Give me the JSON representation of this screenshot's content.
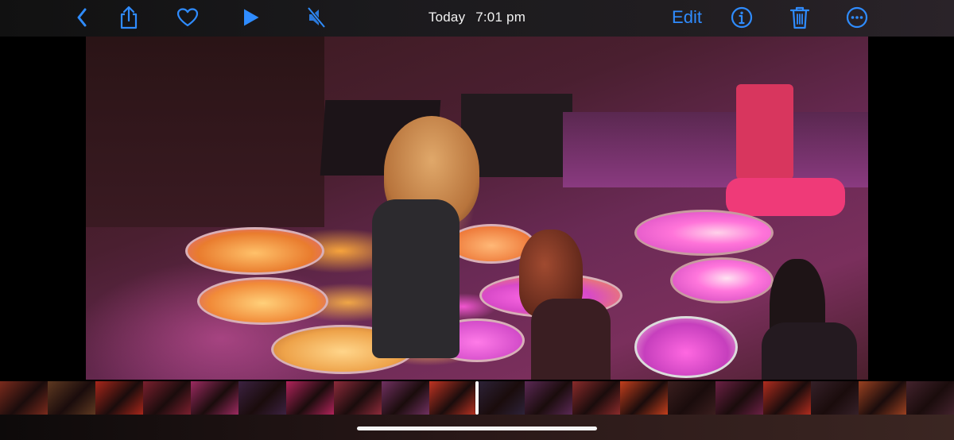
{
  "toolbar": {
    "back_icon": "chevron-left-icon",
    "share_icon": "share-icon",
    "favorite_icon": "heart-icon",
    "play_icon": "play-icon",
    "mute_icon": "speaker-muted-icon",
    "title_day": "Today",
    "title_time": "7:01 pm",
    "edit_label": "Edit",
    "info_icon": "info-icon",
    "delete_icon": "trash-icon",
    "more_icon": "ellipsis-icon",
    "accent_color": "#2f8cff"
  },
  "video": {
    "description_icon": "video-frame",
    "filmstrip_frame_colors": [
      "#7a2a1c",
      "#5e3820",
      "#a8261a",
      "#7b1f2e",
      "#9c2a60",
      "#3b2140",
      "#b1235a",
      "#8d2a3a",
      "#703060",
      "#c03322",
      "#2d2238",
      "#5a2854",
      "#8a2a2a",
      "#c33e1c",
      "#3a1e1e",
      "#6b2044",
      "#b02c1e",
      "#352028",
      "#9a4020",
      "#42222c"
    ]
  }
}
